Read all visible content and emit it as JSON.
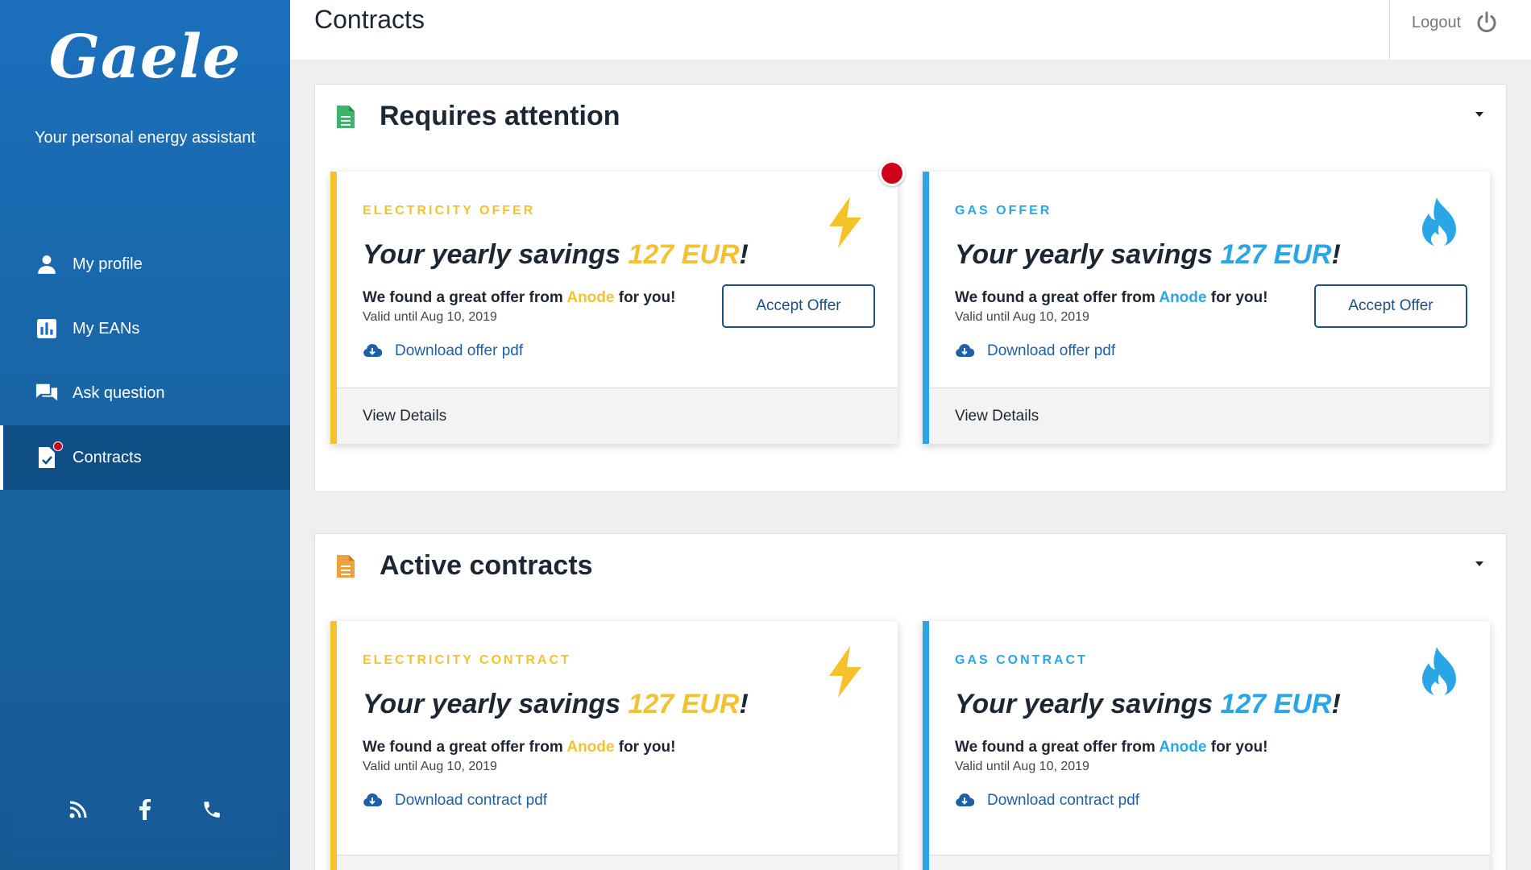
{
  "app": {
    "logo": "Gaele",
    "tagline": "Your personal energy assistant"
  },
  "sidebar": {
    "items": [
      {
        "label": "My profile",
        "icon": "person-icon"
      },
      {
        "label": "My EANs",
        "icon": "chart-icon"
      },
      {
        "label": "Ask question",
        "icon": "chat-icon"
      },
      {
        "label": "Contracts",
        "icon": "contract-icon",
        "active": true,
        "notification": true
      }
    ],
    "social": [
      "rss-icon",
      "facebook-icon",
      "phone-icon"
    ]
  },
  "header": {
    "title": "Contracts",
    "logout_label": "Logout"
  },
  "sections": {
    "attention": {
      "title": "Requires attention",
      "cards": {
        "electricity": {
          "label": "ELECTRICITY OFFER",
          "savings_prefix": "Your yearly savings ",
          "savings_amount": "127 EUR",
          "savings_suffix": "!",
          "offer_prefix": "We found a great offer from ",
          "supplier": "Anode",
          "offer_suffix": " for you!",
          "valid": "Valid until Aug 10, 2019",
          "download": "Download offer pdf",
          "accept": "Accept Offer",
          "footer": "View Details"
        },
        "gas": {
          "label": "GAS OFFER",
          "savings_prefix": "Your yearly savings ",
          "savings_amount": "127 EUR",
          "savings_suffix": "!",
          "offer_prefix": "We found a great offer from ",
          "supplier": "Anode",
          "offer_suffix": " for you!",
          "valid": "Valid until Aug 10, 2019",
          "download": "Download offer pdf",
          "accept": "Accept Offer",
          "footer": "View Details"
        }
      }
    },
    "active": {
      "title": "Active contracts",
      "cards": {
        "electricity": {
          "label": "ELECTRICITY CONTRACT",
          "savings_prefix": "Your yearly savings ",
          "savings_amount": "127 EUR",
          "savings_suffix": "!",
          "offer_prefix": "We found a great offer from ",
          "supplier": "Anode",
          "offer_suffix": " for you!",
          "valid": "Valid until Aug 10, 2019",
          "download": "Download contract pdf"
        },
        "gas": {
          "label": "GAS CONTRACT",
          "savings_prefix": "Your yearly savings ",
          "savings_amount": "127 EUR",
          "savings_suffix": "!",
          "offer_prefix": "We found a great offer from ",
          "supplier": "Anode",
          "offer_suffix": " for you!",
          "valid": "Valid until Aug 10, 2019",
          "download": "Download contract pdf"
        }
      }
    }
  },
  "colors": {
    "sidebar": "#1b6fbc",
    "electricity": "#f6c22b",
    "gas": "#2aa6e6",
    "notification": "#d0021b",
    "button_border": "#1b4f86"
  }
}
